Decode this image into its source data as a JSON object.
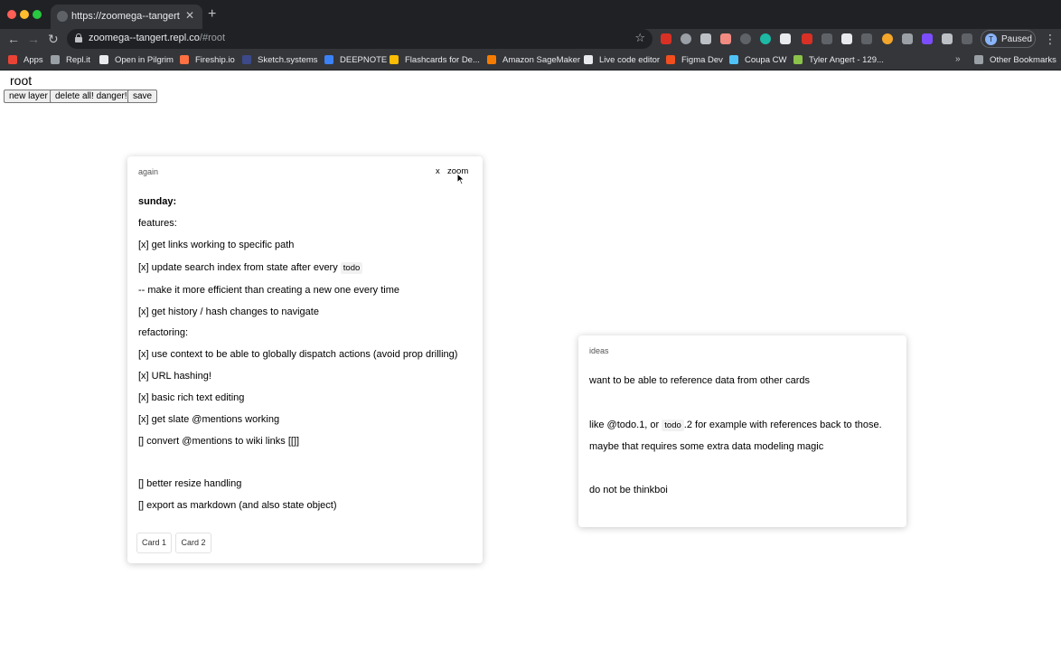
{
  "browser": {
    "tab_title": "https://zoomega--tangert.repl.co",
    "tab_close": "✕",
    "new_tab": "+",
    "url_host": "zoomega--tangert.repl.co",
    "url_path": "/#root",
    "profile_label": "Paused",
    "profile_initial": "T",
    "bookmarks": [
      {
        "label": "Apps",
        "color": "#ea4335"
      },
      {
        "label": "Repl.it",
        "color": "#9aa0a6"
      },
      {
        "label": "Open in Pilgrim",
        "color": "#e8eaed"
      },
      {
        "label": "Fireship.io",
        "color": "#ff7043"
      },
      {
        "label": "Sketch.systems",
        "color": "#3c4a8a"
      },
      {
        "label": "DEEPNOTE",
        "color": "#3b82f6"
      },
      {
        "label": "Flashcards for De...",
        "color": "#fbbc04"
      },
      {
        "label": "Amazon SageMaker",
        "color": "#f57c00"
      },
      {
        "label": "Live code editor",
        "color": "#e8eaed"
      },
      {
        "label": "Figma Dev",
        "color": "#f24e1e"
      },
      {
        "label": "Coupa CW",
        "color": "#4fc3f7"
      },
      {
        "label": "Tyler Angert - 129...",
        "color": "#8bc34a"
      },
      {
        "label": "Other Bookmarks",
        "color": "#9aa0a6"
      }
    ],
    "more_bookmarks": "»"
  },
  "page": {
    "title": "root",
    "buttons": {
      "new_layer": "new layer",
      "delete_all": "delete all! danger!",
      "save": "save"
    }
  },
  "cards": {
    "again": {
      "title": "again",
      "close": "x",
      "zoom": "zoom",
      "heading": "sunday:",
      "lines": [
        "features:",
        "[x] get links working to specific path",
        "[x] update search index from state after every",
        "-- make it more efficient than creating a new one every time",
        "[x] get history / hash changes to navigate",
        "refactoring:",
        "[x] use context to be able to globally dispatch actions (avoid prop drilling)",
        "[x] URL hashing!",
        "[x] basic rich text editing",
        "[x] get slate @mentions working",
        "[] convert @mentions to wiki links [[]]",
        "[] better resize handling",
        "[] export as markdown (and also state object)"
      ],
      "todo_tag": "todo",
      "subcards": [
        "Card 1",
        "Card 2"
      ]
    },
    "ideas": {
      "title": "ideas",
      "line1": "want to be able to reference data from other cards",
      "line2_a": "like @todo.1, or",
      "line2_tag": "todo",
      "line2_b": ".2 for example with references back to those.",
      "line3": "maybe that requires some extra data modeling magic",
      "line4": "do not be thinkboi"
    }
  }
}
